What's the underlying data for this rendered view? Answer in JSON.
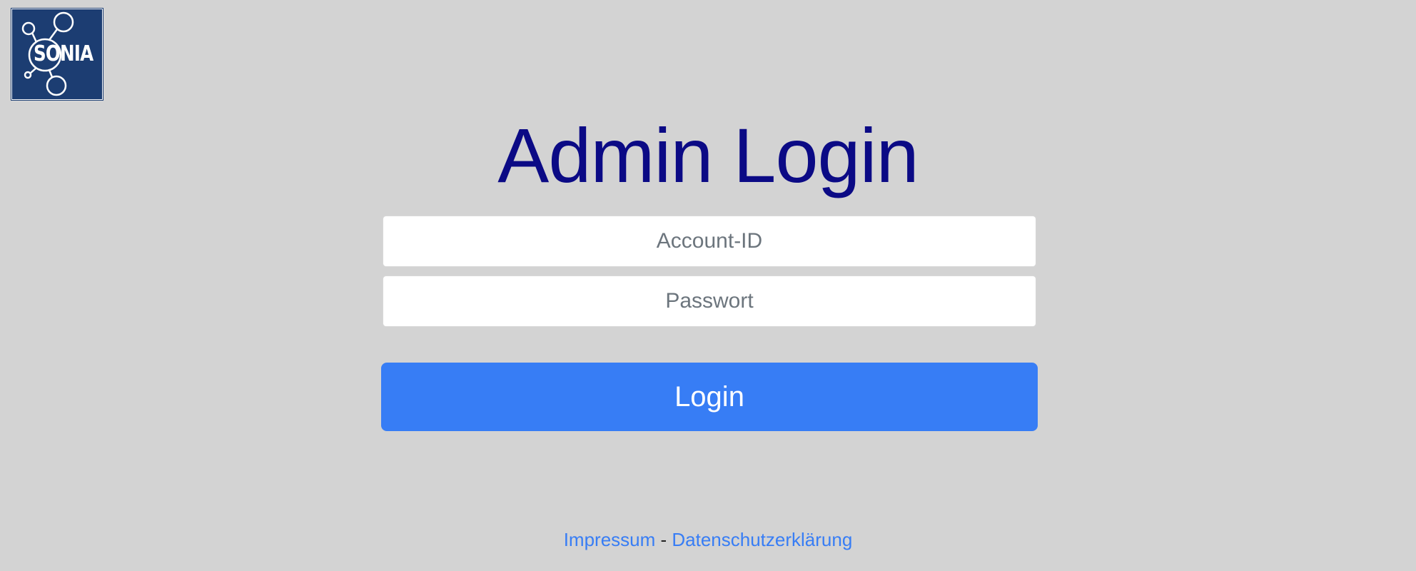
{
  "logo": {
    "text": "SONIA",
    "icon": "network-nodes-icon",
    "background_color": "#1c3d72"
  },
  "page": {
    "title": "Admin Login",
    "background_color": "#d3d3d3",
    "title_color": "#0b0a85"
  },
  "form": {
    "account_placeholder": "Account-ID",
    "account_value": "",
    "password_placeholder": "Passwort",
    "password_value": "",
    "login_label": "Login",
    "button_color": "#377df5"
  },
  "footer": {
    "impressum_label": "Impressum",
    "separator": " - ",
    "privacy_label": "Datenschutzerklärung",
    "link_color": "#377df5"
  }
}
